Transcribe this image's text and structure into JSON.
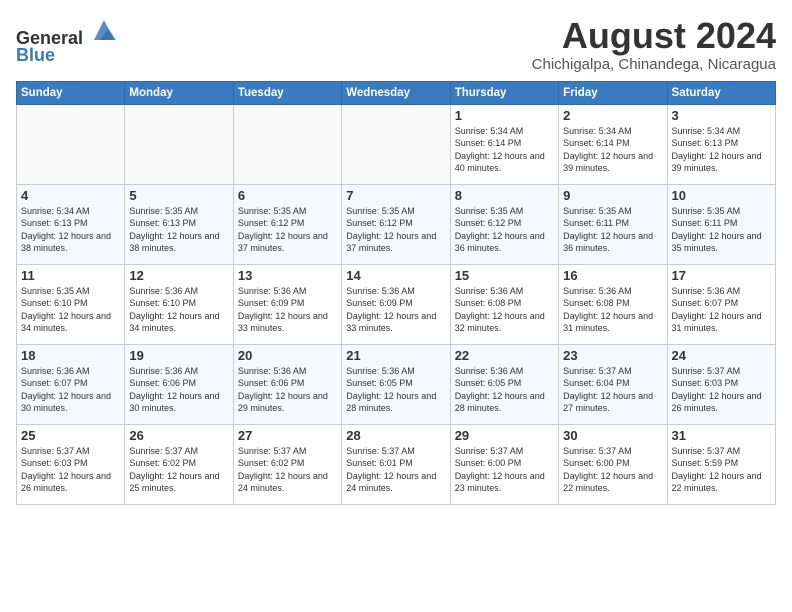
{
  "logo": {
    "line1": "General",
    "line2": "Blue"
  },
  "title": "August 2024",
  "location": "Chichigalpa, Chinandega, Nicaragua",
  "weekdays": [
    "Sunday",
    "Monday",
    "Tuesday",
    "Wednesday",
    "Thursday",
    "Friday",
    "Saturday"
  ],
  "weeks": [
    [
      {
        "day": "",
        "sunrise": "",
        "sunset": "",
        "daylight": ""
      },
      {
        "day": "",
        "sunrise": "",
        "sunset": "",
        "daylight": ""
      },
      {
        "day": "",
        "sunrise": "",
        "sunset": "",
        "daylight": ""
      },
      {
        "day": "",
        "sunrise": "",
        "sunset": "",
        "daylight": ""
      },
      {
        "day": "1",
        "sunrise": "Sunrise: 5:34 AM",
        "sunset": "Sunset: 6:14 PM",
        "daylight": "Daylight: 12 hours and 40 minutes."
      },
      {
        "day": "2",
        "sunrise": "Sunrise: 5:34 AM",
        "sunset": "Sunset: 6:14 PM",
        "daylight": "Daylight: 12 hours and 39 minutes."
      },
      {
        "day": "3",
        "sunrise": "Sunrise: 5:34 AM",
        "sunset": "Sunset: 6:13 PM",
        "daylight": "Daylight: 12 hours and 39 minutes."
      }
    ],
    [
      {
        "day": "4",
        "sunrise": "Sunrise: 5:34 AM",
        "sunset": "Sunset: 6:13 PM",
        "daylight": "Daylight: 12 hours and 38 minutes."
      },
      {
        "day": "5",
        "sunrise": "Sunrise: 5:35 AM",
        "sunset": "Sunset: 6:13 PM",
        "daylight": "Daylight: 12 hours and 38 minutes."
      },
      {
        "day": "6",
        "sunrise": "Sunrise: 5:35 AM",
        "sunset": "Sunset: 6:12 PM",
        "daylight": "Daylight: 12 hours and 37 minutes."
      },
      {
        "day": "7",
        "sunrise": "Sunrise: 5:35 AM",
        "sunset": "Sunset: 6:12 PM",
        "daylight": "Daylight: 12 hours and 37 minutes."
      },
      {
        "day": "8",
        "sunrise": "Sunrise: 5:35 AM",
        "sunset": "Sunset: 6:12 PM",
        "daylight": "Daylight: 12 hours and 36 minutes."
      },
      {
        "day": "9",
        "sunrise": "Sunrise: 5:35 AM",
        "sunset": "Sunset: 6:11 PM",
        "daylight": "Daylight: 12 hours and 36 minutes."
      },
      {
        "day": "10",
        "sunrise": "Sunrise: 5:35 AM",
        "sunset": "Sunset: 6:11 PM",
        "daylight": "Daylight: 12 hours and 35 minutes."
      }
    ],
    [
      {
        "day": "11",
        "sunrise": "Sunrise: 5:35 AM",
        "sunset": "Sunset: 6:10 PM",
        "daylight": "Daylight: 12 hours and 34 minutes."
      },
      {
        "day": "12",
        "sunrise": "Sunrise: 5:36 AM",
        "sunset": "Sunset: 6:10 PM",
        "daylight": "Daylight: 12 hours and 34 minutes."
      },
      {
        "day": "13",
        "sunrise": "Sunrise: 5:36 AM",
        "sunset": "Sunset: 6:09 PM",
        "daylight": "Daylight: 12 hours and 33 minutes."
      },
      {
        "day": "14",
        "sunrise": "Sunrise: 5:36 AM",
        "sunset": "Sunset: 6:09 PM",
        "daylight": "Daylight: 12 hours and 33 minutes."
      },
      {
        "day": "15",
        "sunrise": "Sunrise: 5:36 AM",
        "sunset": "Sunset: 6:08 PM",
        "daylight": "Daylight: 12 hours and 32 minutes."
      },
      {
        "day": "16",
        "sunrise": "Sunrise: 5:36 AM",
        "sunset": "Sunset: 6:08 PM",
        "daylight": "Daylight: 12 hours and 31 minutes."
      },
      {
        "day": "17",
        "sunrise": "Sunrise: 5:36 AM",
        "sunset": "Sunset: 6:07 PM",
        "daylight": "Daylight: 12 hours and 31 minutes."
      }
    ],
    [
      {
        "day": "18",
        "sunrise": "Sunrise: 5:36 AM",
        "sunset": "Sunset: 6:07 PM",
        "daylight": "Daylight: 12 hours and 30 minutes."
      },
      {
        "day": "19",
        "sunrise": "Sunrise: 5:36 AM",
        "sunset": "Sunset: 6:06 PM",
        "daylight": "Daylight: 12 hours and 30 minutes."
      },
      {
        "day": "20",
        "sunrise": "Sunrise: 5:36 AM",
        "sunset": "Sunset: 6:06 PM",
        "daylight": "Daylight: 12 hours and 29 minutes."
      },
      {
        "day": "21",
        "sunrise": "Sunrise: 5:36 AM",
        "sunset": "Sunset: 6:05 PM",
        "daylight": "Daylight: 12 hours and 28 minutes."
      },
      {
        "day": "22",
        "sunrise": "Sunrise: 5:36 AM",
        "sunset": "Sunset: 6:05 PM",
        "daylight": "Daylight: 12 hours and 28 minutes."
      },
      {
        "day": "23",
        "sunrise": "Sunrise: 5:37 AM",
        "sunset": "Sunset: 6:04 PM",
        "daylight": "Daylight: 12 hours and 27 minutes."
      },
      {
        "day": "24",
        "sunrise": "Sunrise: 5:37 AM",
        "sunset": "Sunset: 6:03 PM",
        "daylight": "Daylight: 12 hours and 26 minutes."
      }
    ],
    [
      {
        "day": "25",
        "sunrise": "Sunrise: 5:37 AM",
        "sunset": "Sunset: 6:03 PM",
        "daylight": "Daylight: 12 hours and 26 minutes."
      },
      {
        "day": "26",
        "sunrise": "Sunrise: 5:37 AM",
        "sunset": "Sunset: 6:02 PM",
        "daylight": "Daylight: 12 hours and 25 minutes."
      },
      {
        "day": "27",
        "sunrise": "Sunrise: 5:37 AM",
        "sunset": "Sunset: 6:02 PM",
        "daylight": "Daylight: 12 hours and 24 minutes."
      },
      {
        "day": "28",
        "sunrise": "Sunrise: 5:37 AM",
        "sunset": "Sunset: 6:01 PM",
        "daylight": "Daylight: 12 hours and 24 minutes."
      },
      {
        "day": "29",
        "sunrise": "Sunrise: 5:37 AM",
        "sunset": "Sunset: 6:00 PM",
        "daylight": "Daylight: 12 hours and 23 minutes."
      },
      {
        "day": "30",
        "sunrise": "Sunrise: 5:37 AM",
        "sunset": "Sunset: 6:00 PM",
        "daylight": "Daylight: 12 hours and 22 minutes."
      },
      {
        "day": "31",
        "sunrise": "Sunrise: 5:37 AM",
        "sunset": "Sunset: 5:59 PM",
        "daylight": "Daylight: 12 hours and 22 minutes."
      }
    ]
  ]
}
